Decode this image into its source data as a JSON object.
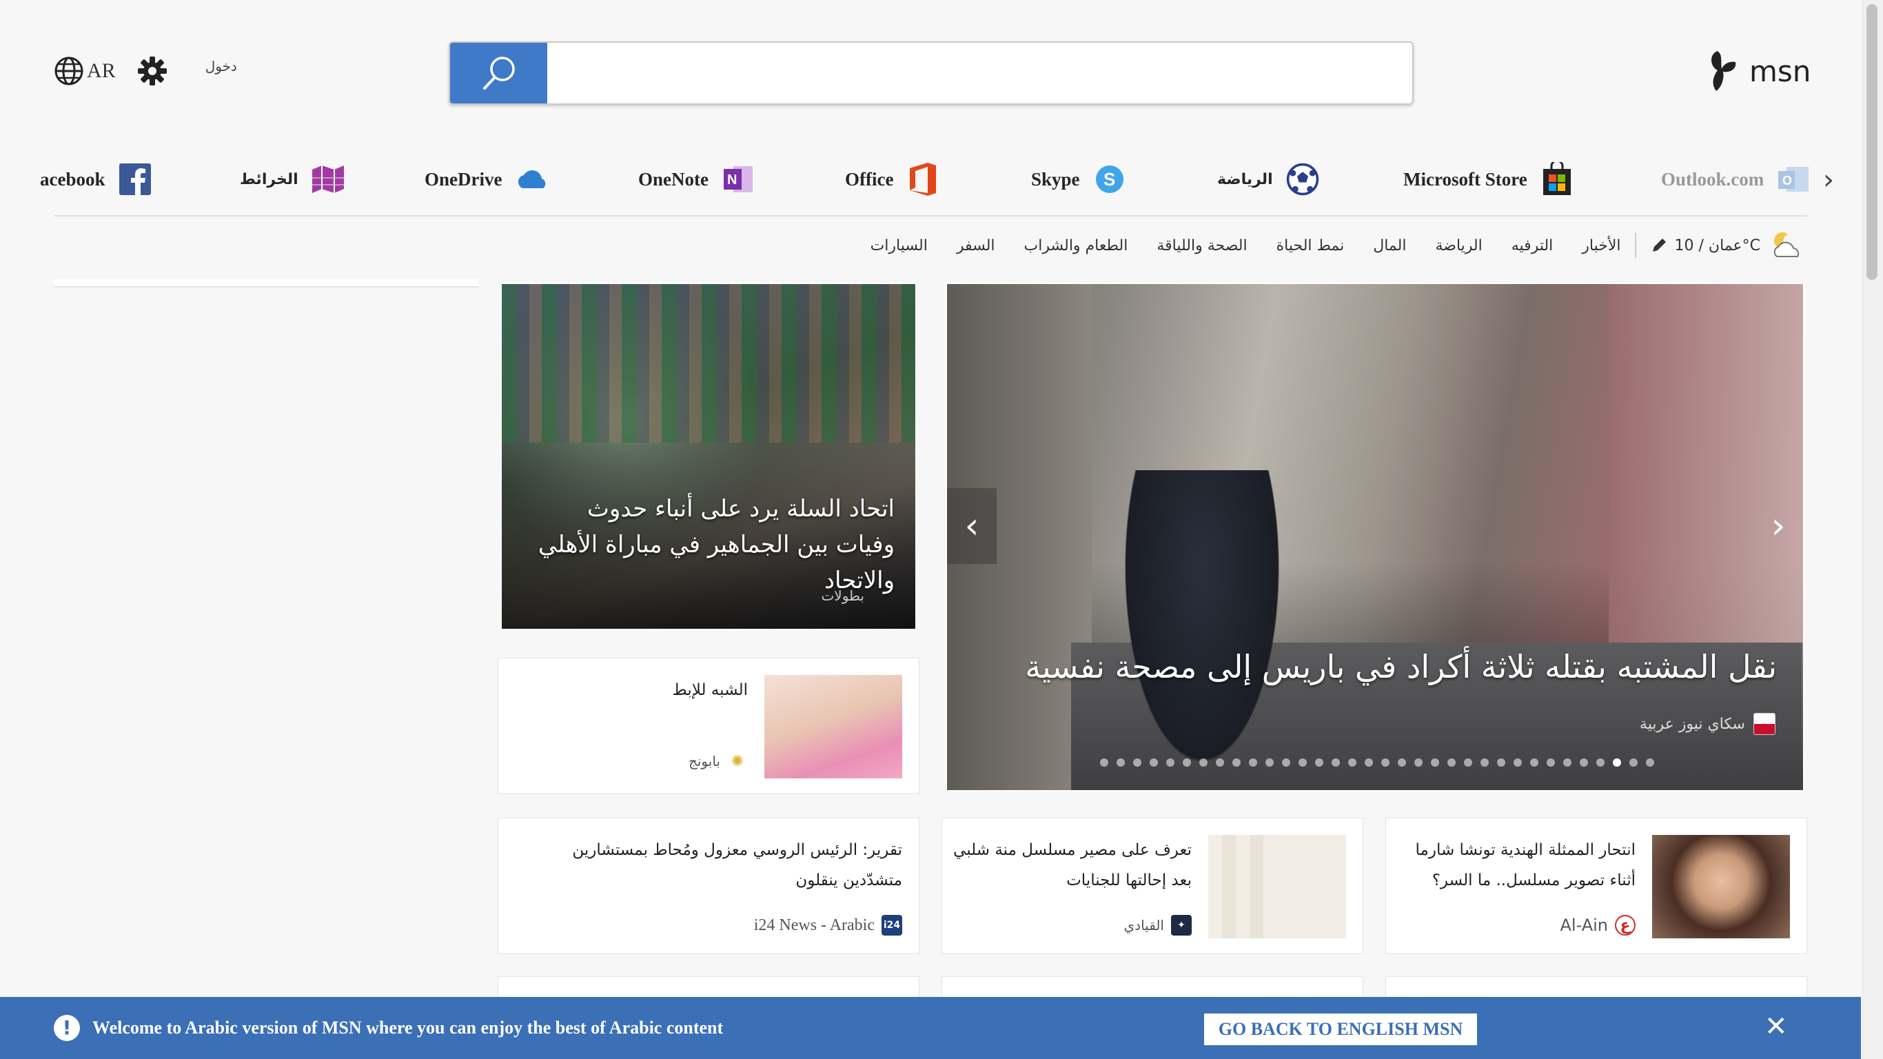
{
  "header": {
    "lang_label": "AR",
    "signin_label": "دخول",
    "search": {
      "value": "",
      "placeholder": ""
    },
    "logo_text": "msn"
  },
  "apps": [
    {
      "label": "Outlook.com",
      "icon": "outlook-icon"
    },
    {
      "label": "Microsoft Store",
      "icon": "store-icon"
    },
    {
      "label": "الرياضة",
      "icon": "soccer-icon"
    },
    {
      "label": "Skype",
      "icon": "skype-icon"
    },
    {
      "label": "Office",
      "icon": "office-icon"
    },
    {
      "label": "OneNote",
      "icon": "onenote-icon"
    },
    {
      "label": "OneDrive",
      "icon": "onedrive-icon"
    },
    {
      "label": "الخرائط",
      "icon": "maps-icon"
    },
    {
      "label": "acebook",
      "icon": "facebook-icon"
    }
  ],
  "nav": {
    "weather": "عمان / 10°C",
    "items": [
      "الأخبار",
      "الترفيه",
      "الرياضة",
      "المال",
      "نمط الحياة",
      "الصحة واللياقة",
      "الطعام والشراب",
      "السفر",
      "السيارات"
    ]
  },
  "hero": {
    "title": "نقل المشتبه بقتله ثلاثة أكراد في باريس إلى مصحة نفسية",
    "source": "سكاي نيوز عربية",
    "dots_total": 34,
    "active_dot": 31
  },
  "feature2": {
    "title": "اتحاد السلة يرد على أنباء حدوث وفيات بين الجماهير في مباراة الأهلي والاتحاد",
    "source": "بطولات"
  },
  "cards": {
    "armpit": {
      "title": "الشبه للإبط",
      "source": "بابونج"
    },
    "actress": {
      "title": "انتحار الممثلة الهندية تونشا شارما أثناء تصوير مسلسل.. ما السر؟",
      "source": "Al-Ain"
    },
    "mona": {
      "title": "تعرف على مصير مسلسل منة شلبي بعد إحالتها للجنايات",
      "source": "القيادي"
    },
    "russia": {
      "title": "تقرير: الرئيس الروسي معزول ومُحاط بمستشارين متشدّدين ينقلون",
      "source": "i24 News - Arabic"
    }
  },
  "banner": {
    "message": "Welcome to Arabic version of MSN where you can enjoy the best of Arabic content",
    "button": "GO BACK TO ENGLISH MSN"
  },
  "colors": {
    "accent": "#3f79c8",
    "banner": "#3b6fb6"
  }
}
